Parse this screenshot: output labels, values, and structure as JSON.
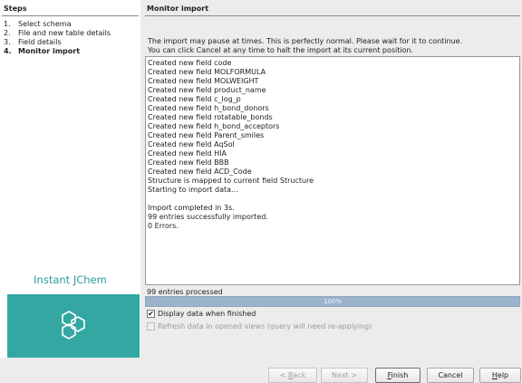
{
  "steps": {
    "title": "Steps",
    "items": [
      {
        "num": "1.",
        "label": "Select schema"
      },
      {
        "num": "2.",
        "label": "File and new table details"
      },
      {
        "num": "3.",
        "label": "Field details"
      },
      {
        "num": "4.",
        "label": "Monitor import"
      }
    ]
  },
  "brand": {
    "name": "Instant JChem",
    "logo_icon": "hexagon-molecule-icon",
    "color": "#34a7a3"
  },
  "main": {
    "title": "Monitor import",
    "info_line1": "The import may pause at times. This is perfectly normal. Please wait for it to continue.",
    "info_line2": "You can click Cancel at any time to halt the import at its current position.",
    "log_lines": [
      "Created new field code",
      "Created new field MOLFORMULA",
      "Created new field MOLWEIGHT",
      "Created new field product_name",
      "Created new field c_log_p",
      "Created new field h_bond_donors",
      "Created new field rotatable_bonds",
      "Created new field h_bond_acceptors",
      "Created new field Parent_smiles",
      "Created new field AqSol",
      "Created new field HIA",
      "Created new field BBB",
      "Created new field ACD_Code",
      "Structure is mapped to current field Structure",
      "Starting to import data...",
      "",
      "Import completed in 3s.",
      "99 entries successfully imported.",
      "0 Errors."
    ],
    "progress_label": "99 entries processed",
    "progress_text": "100%",
    "progress_value": 100,
    "display_data_label": "Display data when finished",
    "display_data_checked": true,
    "refresh_label": "Refresh data in opened views (query will need re-applying)",
    "refresh_checked": false
  },
  "buttons": {
    "back": {
      "mnemonic": "B",
      "rest": "ack",
      "prefix": "< "
    },
    "next": "Next >",
    "finish": {
      "mnemonic": "F",
      "rest": "inish"
    },
    "cancel": "Cancel",
    "help": {
      "mnemonic": "H",
      "rest": "elp"
    }
  }
}
